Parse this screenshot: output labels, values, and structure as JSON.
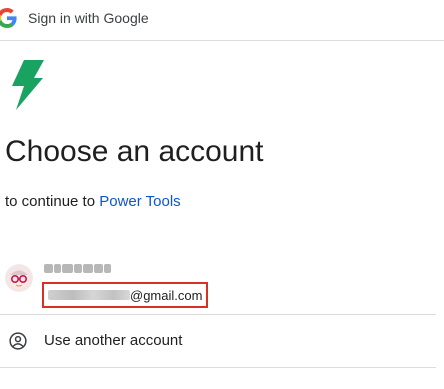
{
  "header": {
    "title": "Sign in with Google",
    "logo_icon": "google-g-icon"
  },
  "app": {
    "logo_icon": "lightning-bolt-icon",
    "logo_color": "#1aa260"
  },
  "main": {
    "heading": "Choose an account",
    "subtitle_prefix": "to continue to ",
    "app_name": "Power Tools"
  },
  "accounts": [
    {
      "name": "",
      "email_suffix": "@gmail.com",
      "avatar_icon": "avatar-glasses-icon"
    }
  ],
  "other_account": {
    "label": "Use another account",
    "icon": "person-circle-icon"
  },
  "colors": {
    "link": "#0b57d0",
    "divider": "#dadce0",
    "highlight": "#d93025"
  }
}
